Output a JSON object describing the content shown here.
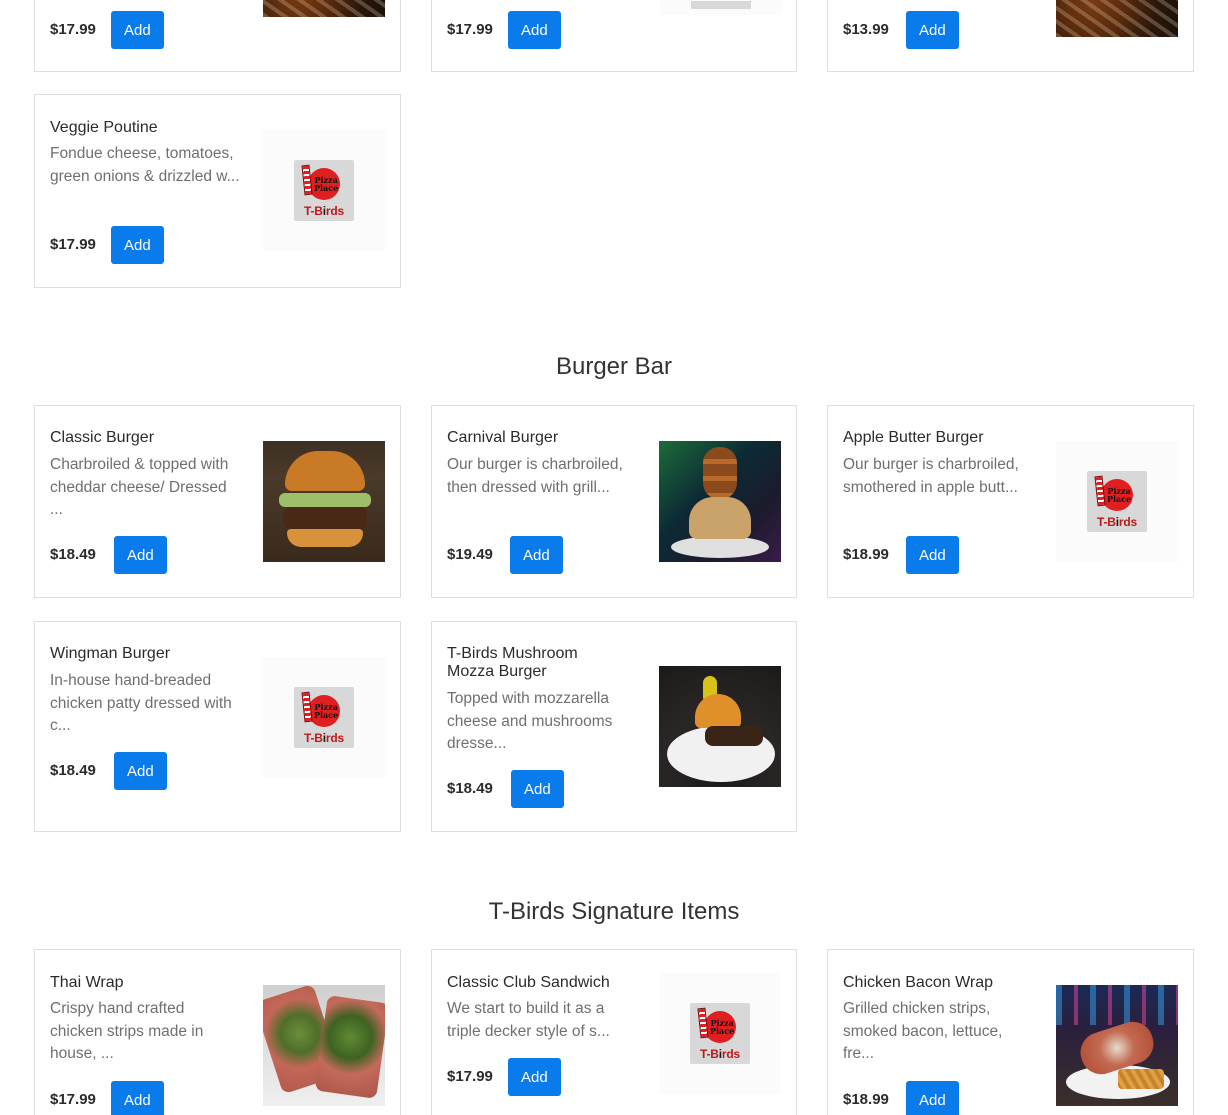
{
  "top_row": [
    {
      "price": "$17.99",
      "add_label": "Add"
    },
    {
      "price": "$17.99",
      "add_label": "Add"
    },
    {
      "price": "$13.99",
      "add_label": "Add"
    }
  ],
  "veggie": {
    "title": "Veggie Poutine",
    "desc": "Fondue cheese, tomatoes, green onions & drizzled w...",
    "price": "$17.99",
    "add_label": "Add"
  },
  "sections": {
    "burger_bar": "Burger Bar",
    "signature": "T-Birds Signature Items"
  },
  "burgers": [
    {
      "title": "Classic Burger",
      "desc": "Charbroiled & topped with cheddar cheese/ Dressed ...",
      "price": "$18.49",
      "add_label": "Add"
    },
    {
      "title": "Carnival Burger",
      "desc": "Our burger is charbroiled, then dressed with grill...",
      "price": "$19.49",
      "add_label": "Add"
    },
    {
      "title": "Apple Butter Burger",
      "desc": "Our burger is charbroiled, smothered in apple butt...",
      "price": "$18.99",
      "add_label": "Add"
    },
    {
      "title": "Wingman Burger",
      "desc": "In-house hand-breaded chicken patty dressed with c...",
      "price": "$18.49",
      "add_label": "Add"
    },
    {
      "title": "T-Birds Mushroom Mozza Burger",
      "desc": "Topped with mozzarella cheese and mushrooms dresse...",
      "price": "$18.49",
      "add_label": "Add"
    }
  ],
  "signature_items": [
    {
      "title": "Thai Wrap",
      "desc": "Crispy hand crafted chicken strips made in house, ...",
      "price": "$17.99",
      "add_label": "Add"
    },
    {
      "title": "Classic Club Sandwich",
      "desc": "We start to build it as a triple decker style of s...",
      "price": "$17.99",
      "add_label": "Add"
    },
    {
      "title": "Chicken Bacon Wrap",
      "desc": "Grilled chicken strips, smoked bacon, lettuce, fre...",
      "price": "$18.99",
      "add_label": "Add"
    }
  ],
  "logo": {
    "line1": "Pizza",
    "line2": "Place",
    "brand_t": "T-",
    "brand_i": "i",
    "brand_rest": "rds",
    "brand_b": "B"
  },
  "colors": {
    "accent": "#0a7bea",
    "border": "#dedede",
    "text": "#2b2b2b",
    "muted": "#6f6f6f"
  }
}
